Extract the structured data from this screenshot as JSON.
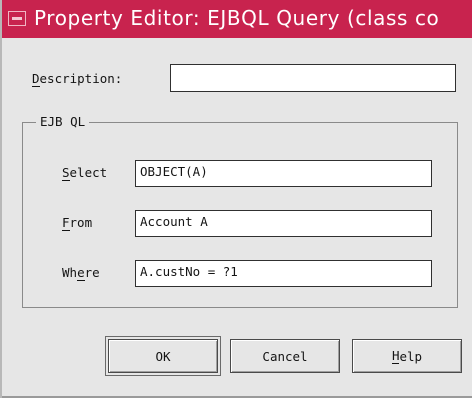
{
  "window": {
    "title": "Property Editor: EJBQL Query (class co"
  },
  "form": {
    "description": {
      "label_first": "D",
      "label_rest": "escription:",
      "value": ""
    }
  },
  "group": {
    "title": "EJB QL",
    "select": {
      "label_first": "S",
      "label_rest": "elect",
      "value": "OBJECT(A)"
    },
    "from": {
      "label_first": "F",
      "label_rest": "rom",
      "value": "Account A"
    },
    "where": {
      "label_first": "W",
      "label_mid": "h",
      "label_u": "e",
      "label_rest": "re",
      "value": "A.custNo = ?1"
    }
  },
  "buttons": {
    "ok": "OK",
    "cancel": "Cancel",
    "help_first": "H",
    "help_rest": "elp"
  },
  "colors": {
    "titlebar": "#c8234e",
    "dialog_bg": "#e6e6e6",
    "field_bg": "#ffffff"
  }
}
